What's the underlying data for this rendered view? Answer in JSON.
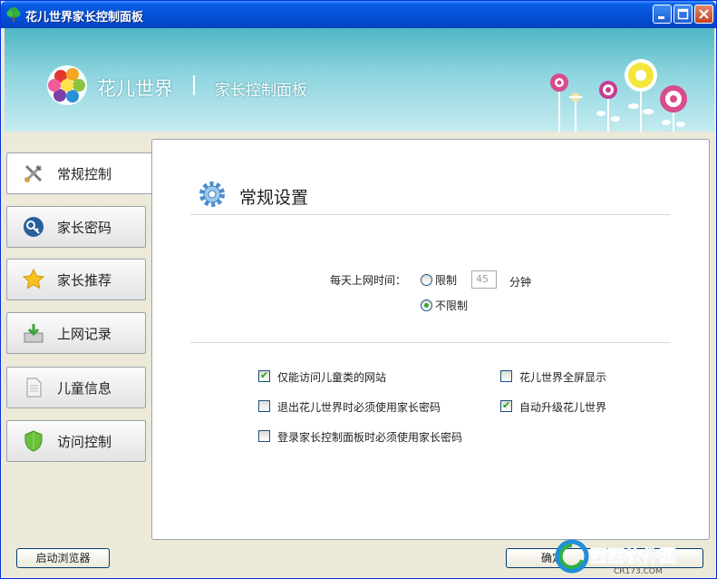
{
  "window": {
    "title": "花儿世界家长控制面板"
  },
  "header": {
    "brand": "花儿世界",
    "separator": "|",
    "panel_name": "家长控制面板"
  },
  "sidebar": {
    "items": [
      {
        "label": "常规控制",
        "icon": "tools-icon",
        "active": true
      },
      {
        "label": "家长密码",
        "icon": "key-icon"
      },
      {
        "label": "家长推荐",
        "icon": "star-icon"
      },
      {
        "label": "上网记录",
        "icon": "inbox-icon"
      },
      {
        "label": "儿童信息",
        "icon": "document-icon"
      },
      {
        "label": "访问控制",
        "icon": "shield-icon"
      }
    ]
  },
  "main": {
    "section_title": "常规设置",
    "time": {
      "label": "每天上网时间：",
      "limit_label": "限制",
      "minutes_value": "45",
      "minutes_unit": "分钟",
      "unlimited_label": "不限制",
      "selected": "unlimited"
    },
    "options": [
      {
        "label": "仅能访问儿童类的网站",
        "checked": true
      },
      {
        "label": "花儿世界全屏显示",
        "checked": false
      },
      {
        "label": "退出花儿世界时必须使用家长密码",
        "checked": false
      },
      {
        "label": "自动升级花儿世界",
        "checked": true
      },
      {
        "label": "登录家长控制面板时必须使用家长密码",
        "checked": false
      }
    ]
  },
  "footer": {
    "browser_button": "启动浏览器",
    "ok_button": "确定"
  },
  "watermark": {
    "text": "西西软件园",
    "sub": "CR173.COM"
  },
  "colors": {
    "titlebar": "#0450d8",
    "banner": "#8ed5df",
    "check": "#21a121"
  }
}
